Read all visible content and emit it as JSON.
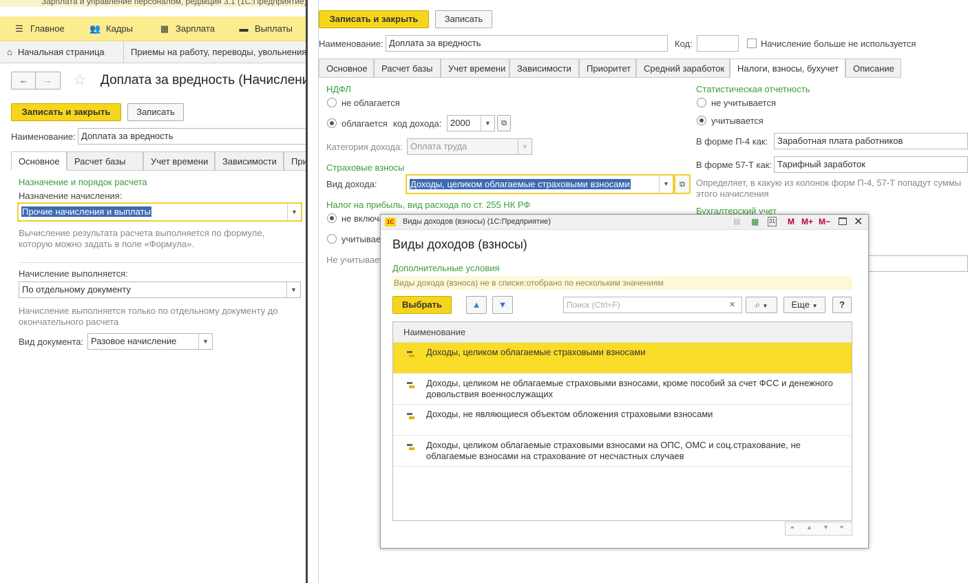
{
  "left_window": {
    "title": "Зарплата и управление персоналом, редакция 3.1  (1С:Предприятие)",
    "menu": [
      {
        "icon": "hamburger-icon",
        "label": "Главное"
      },
      {
        "icon": "people-icon",
        "label": "Кадры"
      },
      {
        "icon": "calculator-icon",
        "label": "Зарплата"
      },
      {
        "icon": "wallet-icon",
        "label": "Выплаты"
      }
    ],
    "nav_tabs": [
      {
        "icon": "home-icon",
        "label": "Начальная страница"
      },
      {
        "label": "Приемы на работу, переводы, увольнения"
      }
    ],
    "form_title": "Доплата за вредность (Начисления)",
    "save_close": "Записать и закрыть",
    "save": "Записать",
    "name_label": "Наименование:",
    "name_value": "Доплата за вредность",
    "tabs": [
      "Основное",
      "Расчет базы",
      "Учет времени",
      "Зависимости",
      "Приоритет"
    ],
    "section_title": "Назначение и порядок расчета",
    "purpose_label": "Назначение начисления:",
    "purpose_value": "Прочие начисления и выплаты",
    "purpose_hint": "Вычисление результата расчета выполняется по формуле, которую можно задать в поле «Формула».",
    "performed_label": "Начисление выполняется:",
    "performed_value": "По отдельному документу",
    "performed_hint": "Начисление выполняется только по отдельному документу до окончательного расчета",
    "doc_type_label": "Вид документа:",
    "doc_type_value": "Разовое начисление"
  },
  "right_window": {
    "save_close": "Записать и закрыть",
    "save": "Записать",
    "name_label": "Наименование:",
    "name_value": "Доплата за вредность",
    "code_label": "Код:",
    "code_value": "",
    "not_used_label": "Начисление больше не используется",
    "tabs": [
      "Основное",
      "Расчет базы",
      "Учет времени",
      "Зависимости",
      "Приоритет",
      "Средний заработок",
      "Налоги, взносы, бухучет",
      "Описание"
    ],
    "active_tab": 6,
    "ndfl_title": "НДФЛ",
    "ndfl_not_taxed": "не облагается",
    "ndfl_taxed": "облагается",
    "income_code_label": "код дохода:",
    "income_code_value": "2000",
    "income_category_label": "Категория дохода:",
    "income_category_value": "Оплата труда",
    "insurance_title": "Страховые взносы",
    "income_type_label": "Вид дохода:",
    "income_type_value": "Доходы, целиком облагаемые страховыми взносами",
    "profit_tax_title": "Налог на прибыль, вид расхода по ст. 255 НК РФ",
    "profit_option1": "не включается",
    "profit_option2": "учитывается",
    "profit_note": "Не учитывается",
    "stat_title": "Статистическая отчетность",
    "stat_not_counted": "не учитывается",
    "stat_counted": "учитывается",
    "p4_label": "В форме П-4 как:",
    "p4_value": "Заработная плата работников",
    "f57_label": "В форме 57-Т как:",
    "f57_value": "Тарифный заработок",
    "stat_hint": "Определяет, в какую из колонок форм П-4, 57-Т попадут суммы этого начисления",
    "accounting_title": "Бухгалтерский учет",
    "accounting_field_tail": "ски"
  },
  "dialog": {
    "title": "Виды доходов (взносы)  (1С:Предприятие)",
    "toolbar_icons": [
      "print-icon",
      "table-icon",
      "calendar-icon",
      "m-icon",
      "m-plus-icon",
      "m-minus-icon",
      "maximize-icon",
      "close-icon"
    ],
    "toolbar_text": [
      "31",
      "M",
      "M+",
      "M−"
    ],
    "heading": "Виды доходов (взносы)",
    "extra_conditions": "Дополнительные условия",
    "filter_note": "Виды дохода (взноса) не в списке:отобрано по нескольким значениям",
    "select_btn": "Выбрать",
    "search_placeholder": "Поиск (Ctrl+F)",
    "more_btn": "Еще",
    "help_btn": "?",
    "column_header": "Наименование",
    "rows": [
      "Доходы, целиком облагаемые страховыми взносами",
      "Доходы, целиком не облагаемые страховыми взносами, кроме пособий за счет ФСС и денежного довольствия военнослужащих",
      "Доходы, не являющиеся объектом обложения страховыми взносами",
      "Доходы, целиком облагаемые страховыми взносами на ОПС, ОМС и соц.страхование, не облагаемые взносами на страхование от несчастных случаев"
    ],
    "selected_row": 0
  },
  "colors": {
    "accent_yellow": "#f6d61c",
    "menu_bg": "#fbec8f",
    "green": "#3b9c3b",
    "selection": "#3d6ab3"
  }
}
